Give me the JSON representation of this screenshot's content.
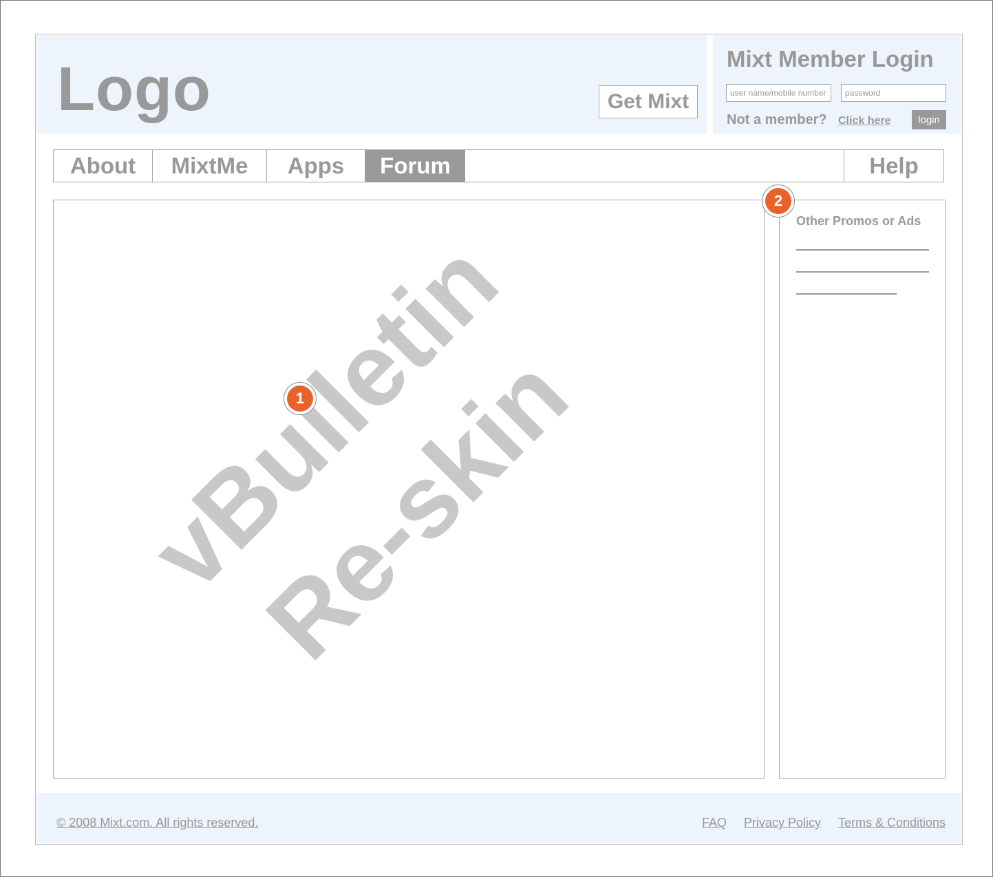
{
  "header": {
    "logo": "Logo",
    "get_mixt": "Get Mixt"
  },
  "login": {
    "title": "Mixt Member Login",
    "username_placeholder": "user name/mobile number",
    "password_placeholder": "password",
    "not_member": "Not a member?",
    "click_here": "Click here",
    "login_button": "login"
  },
  "nav": {
    "items": [
      {
        "label": "About"
      },
      {
        "label": "MixtMe"
      },
      {
        "label": "Apps"
      },
      {
        "label": "Forum",
        "active": true
      },
      {
        "label": "Help"
      }
    ]
  },
  "content": {
    "watermark_line1": "vBulletin",
    "watermark_line2": "Re-skin",
    "badge_main": "1"
  },
  "sidebar": {
    "badge": "2",
    "title": "Other Promos or Ads"
  },
  "footer": {
    "copyright": "© 2008 Mixt.com. All rights reserved.",
    "links": [
      {
        "label": "FAQ"
      },
      {
        "label": "Privacy Policy"
      },
      {
        "label": "Terms & Conditions"
      }
    ]
  },
  "colors": {
    "accent": "#e8622a",
    "header_bg": "#edf4fb",
    "text_gray": "#999999"
  }
}
